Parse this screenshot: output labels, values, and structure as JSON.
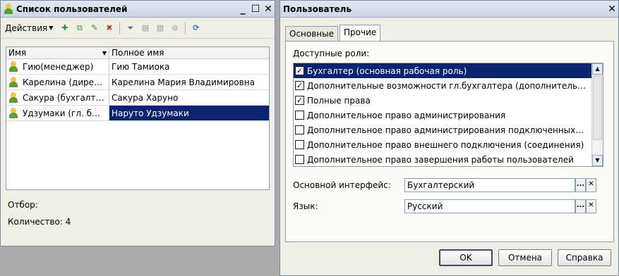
{
  "left_window": {
    "title": "Список пользователей",
    "title_buttons": [
      "_",
      "☐",
      "✕"
    ],
    "toolbar": {
      "actions_label": "Действия"
    },
    "columns": [
      "Имя",
      "Полное имя"
    ],
    "rows": [
      {
        "name": "Гию(менеджер)",
        "full_name": "Гию Тамиока"
      },
      {
        "name": "Карелина (дире…",
        "full_name": "Карелина Мария Владимировна"
      },
      {
        "name": "Сакура (бухгалт…",
        "full_name": "Сакура Харуно"
      },
      {
        "name": "Удзумаки (гл. б…",
        "full_name": "Наруто Удзумаки"
      }
    ],
    "filter_label": "Отбор:",
    "count_label": "Количество: 4"
  },
  "right_window": {
    "title": "Пользователь",
    "close_label": "✕",
    "tabs": [
      "Основные",
      "Прочие"
    ],
    "roles_label": "Доступные роли:",
    "roles": [
      {
        "label": "Бухгалтер (основная рабочая роль)",
        "checked": true
      },
      {
        "label": "Дополнительные возможности гл.бухгалтера (дополнитель…",
        "checked": true
      },
      {
        "label": "Полные права",
        "checked": true
      },
      {
        "label": "Дополнительное право администрирования",
        "checked": false
      },
      {
        "label": "Дополнительное право администрирования подключенных…",
        "checked": false
      },
      {
        "label": "Дополнительное право внешнего подключения (соединения)",
        "checked": false
      },
      {
        "label": "Дополнительное право завершения работы пользователей",
        "checked": false
      }
    ],
    "interface_label": "Основной интерфейс:",
    "interface_value": "Бухгалтерский",
    "language_label": "Язык:",
    "language_value": "Русский",
    "ok_label": "OK",
    "cancel_label": "Отмена",
    "help_label": "Справка"
  }
}
